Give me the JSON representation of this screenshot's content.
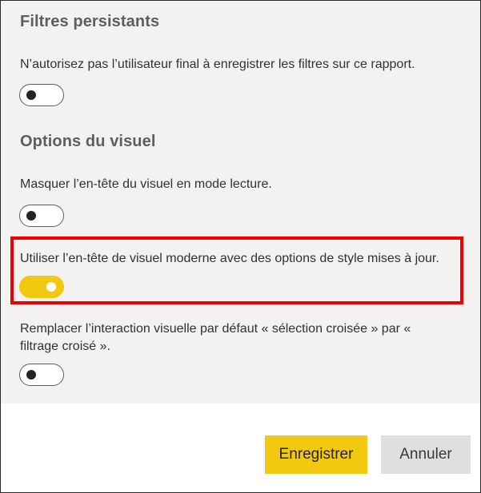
{
  "persistent_filters": {
    "title": "Filtres persistants",
    "description": "N’autorisez pas l’utilisateur final à enregistrer les filtres sur ce rapport.",
    "toggle_on": false
  },
  "visual_options": {
    "title": "Options du visuel",
    "options": [
      {
        "description": "Masquer l’en-tête du visuel en mode lecture.",
        "toggle_on": false
      },
      {
        "description": "Utiliser l’en-tête de visuel moderne avec des options de style mises à jour.",
        "toggle_on": true
      },
      {
        "description": "Remplacer l’interaction visuelle par défaut « sélection croisée » par « filtrage croisé ».",
        "toggle_on": false
      }
    ]
  },
  "footer": {
    "save_label": "Enregistrer",
    "cancel_label": "Annuler"
  },
  "colors": {
    "accent": "#f2c811",
    "highlight_border": "#ee0000",
    "panel_background": "#f3f2f1"
  }
}
